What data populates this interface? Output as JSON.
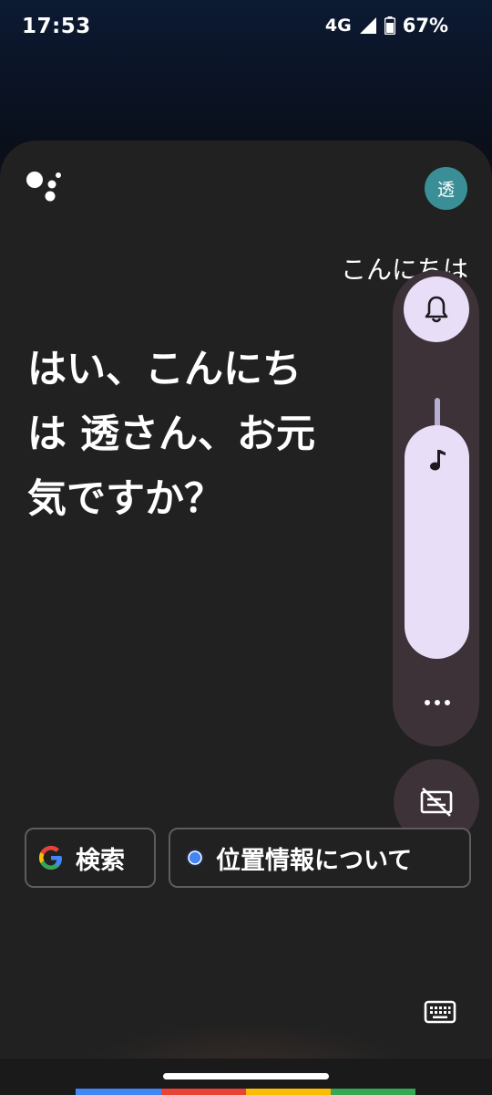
{
  "status_bar": {
    "time": "17:53",
    "network": "4G",
    "battery": "67%"
  },
  "assistant": {
    "avatar_initial": "透",
    "user_query": "こんにちは",
    "response_lines": [
      "はい、こんにち",
      "は 透さん、お元",
      "気ですか？"
    ]
  },
  "volume_panel": {
    "level": 0.88
  },
  "chips": {
    "search_label": "検索",
    "location_label": "位置情報について"
  },
  "colors": {
    "accent_lavender": "#e8def8",
    "panel_bg": "#3c3238",
    "sheet_bg": "#212121",
    "google_blue": "#4285f4",
    "google_red": "#ea4335",
    "google_yellow": "#fbbc04",
    "google_green": "#34a853"
  }
}
